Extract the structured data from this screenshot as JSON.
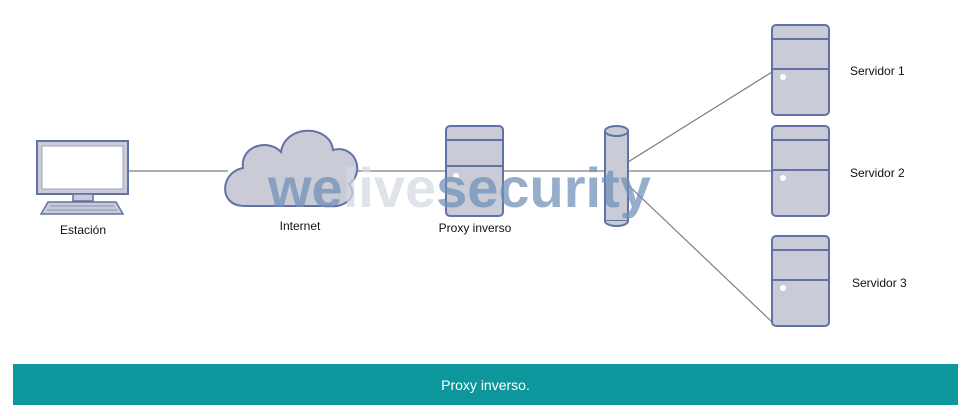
{
  "diagram": {
    "nodes": {
      "station": "Estación",
      "internet": "Internet",
      "proxy": "Proxy inverso",
      "server1": "Servidor 1",
      "server2": "Servidor 2",
      "server3": "Servidor 3"
    },
    "watermark": {
      "part1": "we",
      "part2": "live",
      "part3": "security"
    },
    "colors": {
      "device_fill": "#c9ccd6",
      "device_stroke": "#6272a6",
      "line": "#7c7f88",
      "watermark_blue": "#6f90b8",
      "caption_bg": "#0d979c"
    }
  },
  "caption": "Proxy inverso."
}
